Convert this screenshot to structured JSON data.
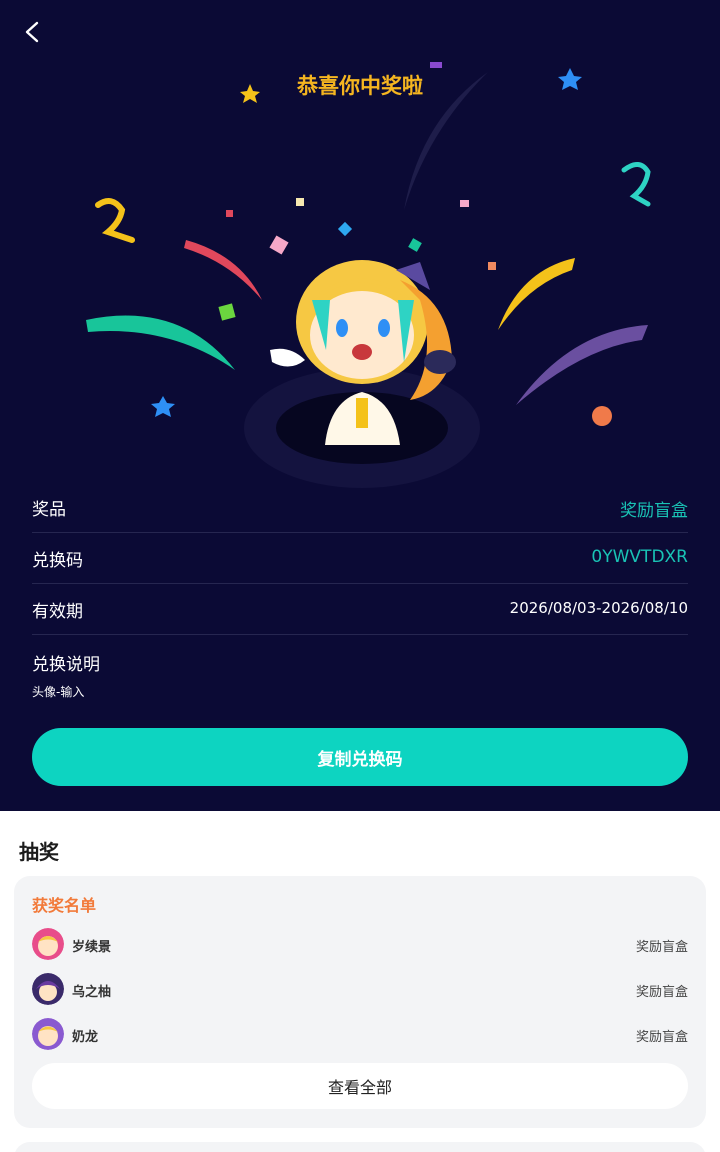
{
  "status_bar": {
    "left_text": "",
    "right_text": ""
  },
  "header": {
    "title": "恭喜你中奖啦"
  },
  "prize_info": {
    "prize_label": "奖品",
    "prize_value": "奖励盲盒",
    "code_label": "兑换码",
    "code_value": "0YWVTDXR",
    "validity_label": "有效期",
    "validity_value": "2026/08/03-2026/08/10",
    "instructions_label": "兑换说明",
    "instructions_text": "头像-输入"
  },
  "copy_button": {
    "label": "复制兑换码"
  },
  "lottery": {
    "section_title": "抽奖",
    "winners_title": "获奖名单",
    "winners": [
      {
        "name": "岁续景",
        "prize": "奖励盲盒"
      },
      {
        "name": "乌之柚",
        "prize": "奖励盲盒"
      },
      {
        "name": "奶龙",
        "prize": "奖励盲盒"
      }
    ],
    "view_all_label": "查看全部"
  },
  "colors": {
    "hero_bg": "#0b0a35",
    "title": "#f5b520",
    "accent_teal": "#0dd4c1",
    "winners_title": "#f27a3a"
  }
}
